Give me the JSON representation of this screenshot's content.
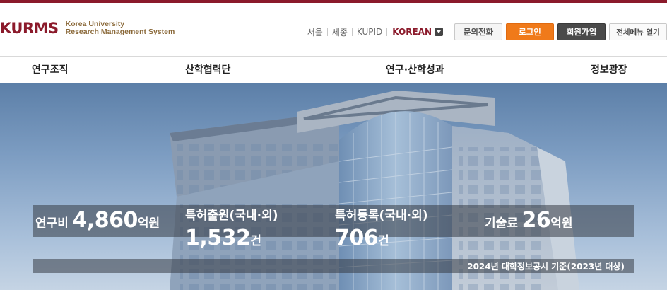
{
  "header": {
    "logo_mark": "KURMS",
    "logo_line1": "Korea University",
    "logo_line2": "Research Management System",
    "links": [
      "서울",
      "세종",
      "KUPID"
    ],
    "language": "KOREAN",
    "inquiry_button": "문의전화",
    "login_button": "로그인",
    "join_button": "회원가입",
    "menu_button": "전체메뉴 열기"
  },
  "nav": {
    "items": [
      "연구조직",
      "산학협력단",
      "연구·산학성과",
      "정보광장"
    ]
  },
  "stats": {
    "research_funds": {
      "label": "연구비",
      "value": "4,860",
      "unit": "억원"
    },
    "patent_applications": {
      "label": "특허출원(국내·외)",
      "value": "1,532",
      "unit": "건"
    },
    "patent_registrations": {
      "label": "특허등록(국내·외)",
      "value": "706",
      "unit": "건"
    },
    "tech_fees": {
      "label": "기술료",
      "value": "26",
      "unit": "억원"
    },
    "basis": "2024년 대학정보공시 기준(2023년 대상)"
  },
  "colors": {
    "brand": "#8b1a2b",
    "login": "#f07a1a",
    "join": "#4a4a4a"
  }
}
